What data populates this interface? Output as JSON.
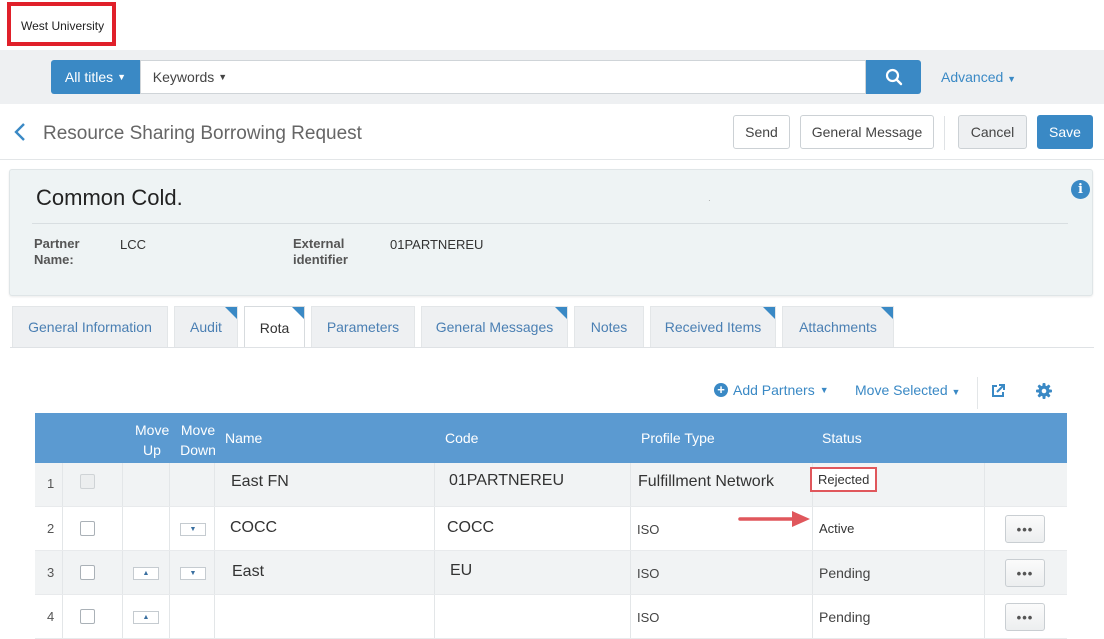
{
  "institution": {
    "name": "West University"
  },
  "search": {
    "scope": "All titles",
    "type": "Keywords",
    "value": "",
    "advanced": "Advanced"
  },
  "header": {
    "title": "Resource Sharing Borrowing Request",
    "send": "Send",
    "general_message": "General Message",
    "cancel": "Cancel",
    "save": "Save"
  },
  "record": {
    "title": "Common Cold.",
    "partner_label": "Partner Name:",
    "partner_value": "LCC",
    "external_label": "External identifier",
    "external_value": "01PARTNEREU"
  },
  "tabs": [
    {
      "label": "General Information",
      "active": false,
      "has_content": false
    },
    {
      "label": "Audit",
      "active": false,
      "has_content": true
    },
    {
      "label": "Rota",
      "active": true,
      "has_content": true
    },
    {
      "label": "Parameters",
      "active": false,
      "has_content": false
    },
    {
      "label": "General Messages",
      "active": false,
      "has_content": true
    },
    {
      "label": "Notes",
      "active": false,
      "has_content": false
    },
    {
      "label": "Received Items",
      "active": false,
      "has_content": true
    },
    {
      "label": "Attachments",
      "active": false,
      "has_content": true
    }
  ],
  "list_toolbar": {
    "add_partners": "Add Partners",
    "move_selected": "Move Selected"
  },
  "table": {
    "headers": {
      "move_up": "Move Up",
      "move_down": "Move Down",
      "name": "Name",
      "code": "Code",
      "profile_type": "Profile Type",
      "status": "Status"
    },
    "rows": [
      {
        "num": "1",
        "name": "East FN",
        "code": "01PARTNEREU",
        "profile_type": "Fulfillment Network",
        "status": "Rejected"
      },
      {
        "num": "2",
        "name": "COCC",
        "code": "COCC",
        "profile_type": "ISO",
        "status": "Active"
      },
      {
        "num": "3",
        "name": "East",
        "code": "EU",
        "profile_type": "ISO",
        "status": "Pending"
      },
      {
        "num": "4",
        "name": "",
        "code": "",
        "profile_type": "ISO",
        "status": "Pending"
      }
    ]
  },
  "more_label": "•••",
  "colors": {
    "accent": "#3a89c5",
    "table_header": "#5b9ad1",
    "highlight": "#e0575c"
  }
}
